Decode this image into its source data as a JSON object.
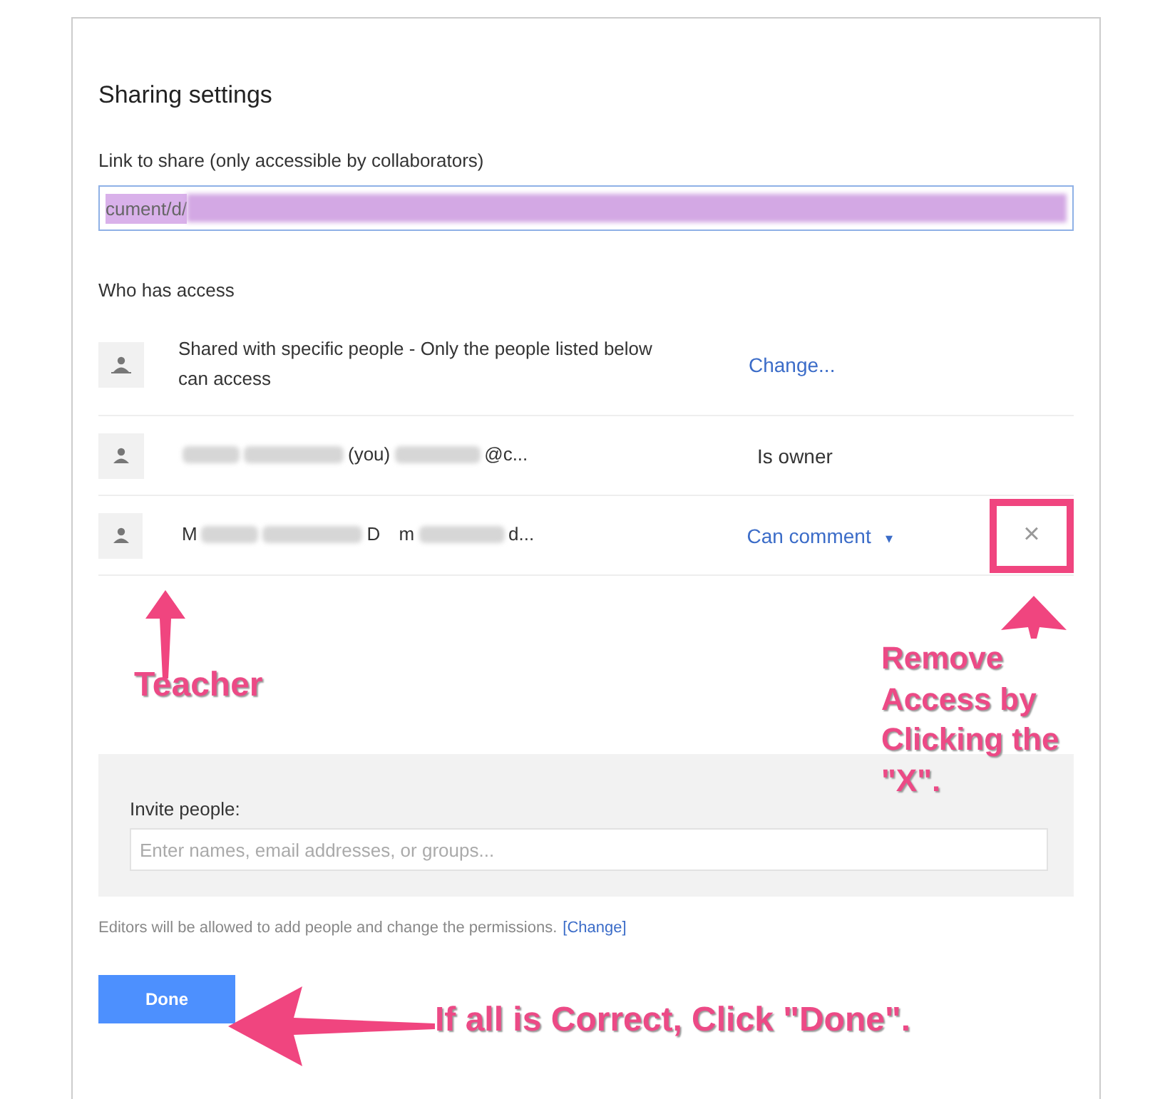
{
  "dialog": {
    "title": "Sharing settings",
    "link": {
      "label": "Link to share (only accessible by collaborators)",
      "value": "cument/d/"
    },
    "access": {
      "heading": "Who has access",
      "rows": [
        {
          "kind": "visibility",
          "text": "Shared with specific people - Only the people listed below can access",
          "action": "Change..."
        },
        {
          "kind": "person",
          "name_tail": "(you)",
          "email_tail": "@c...",
          "role": "Is owner",
          "role_menu": false
        },
        {
          "kind": "person",
          "name_head": "M",
          "name_tail": "D",
          "email_head": "m",
          "email_tail": "d...",
          "role": "Can comment",
          "role_menu": true,
          "caret": "▾",
          "remove_label": "×"
        }
      ]
    },
    "invite": {
      "label": "Invite people:",
      "placeholder": "Enter names, email addresses, or groups..."
    },
    "footer": {
      "text": "Editors will be allowed to add people and change the permissions.",
      "link": "[Change]"
    },
    "done": "Done"
  },
  "annotations": [
    {
      "kind": "teacher",
      "text": "Teacher"
    },
    {
      "kind": "remove",
      "text": "Remove Access by Clicking the \"X\"."
    },
    {
      "kind": "done",
      "text": "If all is Correct, Click \"Done\"."
    }
  ]
}
